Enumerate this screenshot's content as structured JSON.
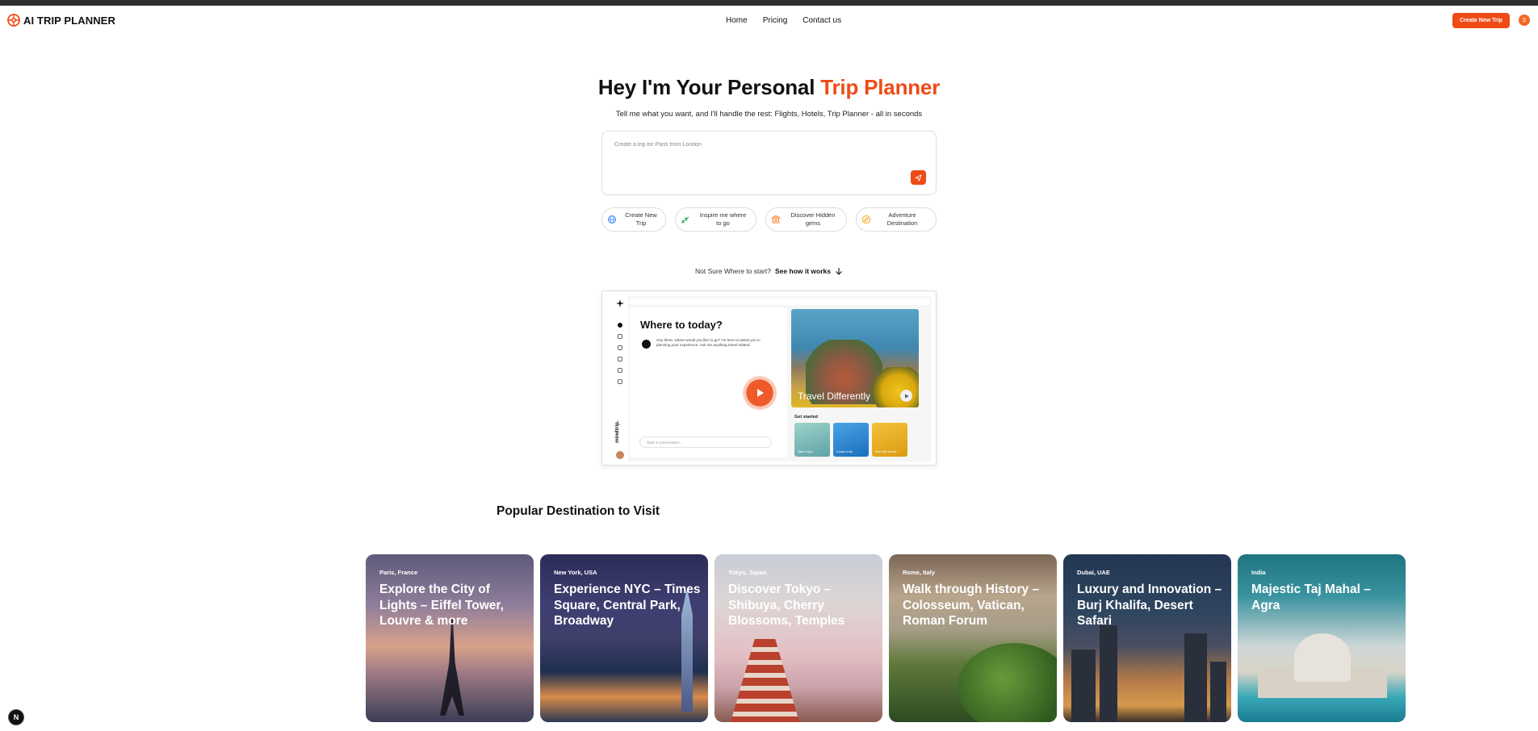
{
  "header": {
    "logo_text": "AI TRIP PLANNER",
    "nav": [
      "Home",
      "Pricing",
      "Contact us"
    ],
    "cta_label": "Create New Trip",
    "avatar_initial": "S"
  },
  "hero": {
    "title_prefix": "Hey I'm Your Personal ",
    "title_accent": "Trip Planner",
    "subtitle": "Tell me what you want, and I'll handle the rest: Flights, Hotels, Trip Planner - all in seconds",
    "input_placeholder": "Create a trip for Paris from London"
  },
  "chips": [
    {
      "label": "Create New Trip",
      "icon": "globe-icon"
    },
    {
      "label": "Inspire me where to go",
      "icon": "plane-icon"
    },
    {
      "label": "Discover Hidden gems",
      "icon": "landmark-icon"
    },
    {
      "label": "Adventure Destination",
      "icon": "compass-icon"
    }
  ],
  "how": {
    "prefix": "Not Sure Where to start?",
    "link": "See how it works"
  },
  "demo": {
    "heading": "Where to today?",
    "message": "Hey there, where would you like to go? I'm here to assist you in planning your experience. Ask me anything travel related.",
    "input_placeholder": "Start a conversation...",
    "photo_title": "Travel Differently",
    "get_started": "Get started",
    "brand": "mindtrip.",
    "tiles": [
      "Take a Quiz",
      "Create a trip",
      "Plan with friends"
    ]
  },
  "popular": {
    "title": "Popular Destination to Visit",
    "cards": [
      {
        "location": "Paris, France",
        "title": "Explore the City of Lights – Eiffel Tower, Louvre & more"
      },
      {
        "location": "New York, USA",
        "title": "Experience NYC – Times Square, Central Park, Broadway"
      },
      {
        "location": "Tokyo, Japan",
        "title": "Discover Tokyo – Shibuya, Cherry Blossoms, Temples"
      },
      {
        "location": "Rome, Italy",
        "title": "Walk through History – Colosseum, Vatican, Roman Forum"
      },
      {
        "location": "Dubai, UAE",
        "title": "Luxury and Innovation – Burj Khalifa, Desert Safari"
      },
      {
        "location": "India",
        "title": "Majestic Taj Mahal – Agra"
      }
    ]
  },
  "dev_badge": "N",
  "colors": {
    "accent": "#ef4b17",
    "text": "#111111",
    "border": "#dddddd"
  }
}
